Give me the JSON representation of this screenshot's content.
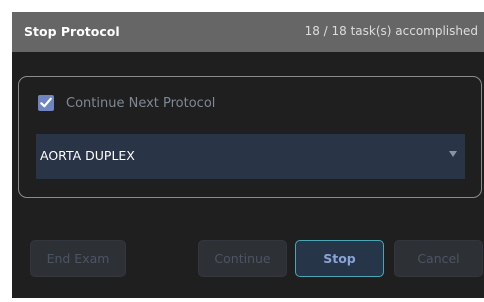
{
  "dialog": {
    "title": "Stop Protocol",
    "task_status": "18 / 18 task(s) accomplished"
  },
  "options": {
    "continue_next_protocol": {
      "label": "Continue Next Protocol",
      "checked": true
    },
    "protocol_select": {
      "value": "AORTA DUPLEX"
    }
  },
  "buttons": {
    "end_exam": "End Exam",
    "continue": "Continue",
    "stop": "Stop",
    "cancel": "Cancel"
  },
  "colors": {
    "background": "#1f1f1f",
    "header": "#666666",
    "checkbox": "#6f84c1",
    "select_background": "#293446",
    "active_button_border": "#4aa6b7"
  },
  "icons": {
    "checkbox": "checkmark-icon",
    "select": "chevron-down-icon"
  }
}
